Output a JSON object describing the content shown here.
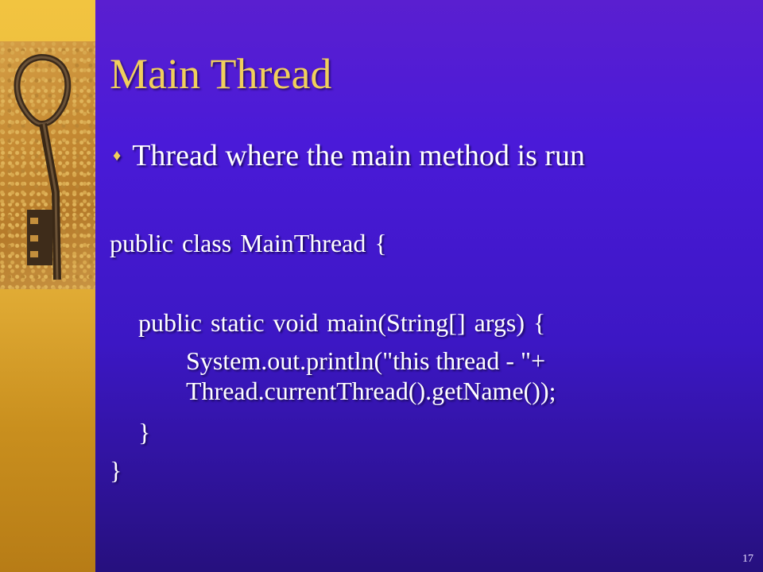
{
  "slide": {
    "title": "Main Thread",
    "bullet_icon": "diamond-bullet-icon",
    "bullet_text": "Thread where the main method is run",
    "code": {
      "line1": "public class MainThread {",
      "line2": "public static void main(String[] args) {",
      "line3": "System.out.println(\"this thread - \"+",
      "line4": "Thread.currentThread().getName());",
      "line5": "}",
      "line6": "}"
    },
    "page_number": "17"
  },
  "colors": {
    "title": "#f0cf5c",
    "text": "#ffffff",
    "background": "#4a1ad8",
    "left_band": "#e6b23a"
  }
}
